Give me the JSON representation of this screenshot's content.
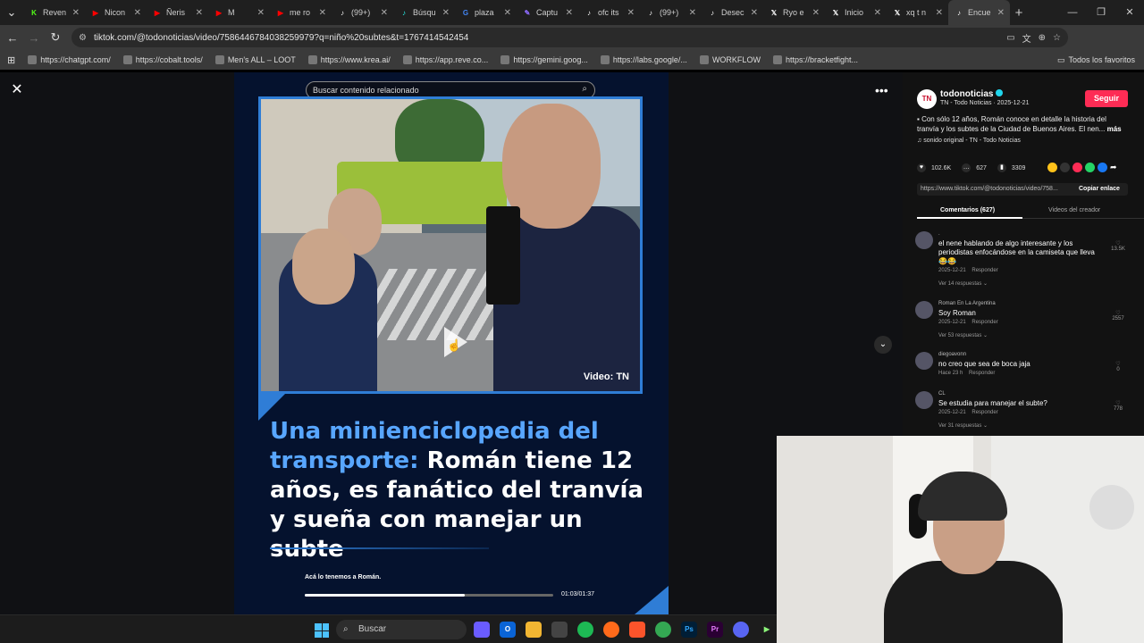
{
  "browser": {
    "tabs": [
      {
        "label": "Reven",
        "icon": "kick-icon",
        "color": "#53fc18"
      },
      {
        "label": "Nicon",
        "icon": "youtube-icon",
        "color": "#ff0000"
      },
      {
        "label": "Ñeris",
        "icon": "youtube-icon",
        "color": "#ff0000"
      },
      {
        "label": "M",
        "icon": "youtube-icon",
        "color": "#ff0000"
      },
      {
        "label": "me ro",
        "icon": "youtube-icon",
        "color": "#ff0000"
      },
      {
        "label": "(99+)",
        "icon": "tiktok-icon",
        "color": "#ffffff"
      },
      {
        "label": "Búsqu",
        "icon": "tiktok-icon",
        "color": "#25f4ee"
      },
      {
        "label": "plaza",
        "icon": "google-icon",
        "color": "#4285f4"
      },
      {
        "label": "Captu",
        "icon": "feather-icon",
        "color": "#8e6cff"
      },
      {
        "label": "ofc its",
        "icon": "tiktok-icon",
        "color": "#ffffff"
      },
      {
        "label": "(99+)",
        "icon": "tiktok-icon",
        "color": "#ffffff"
      },
      {
        "label": "Desec",
        "icon": "tiktok-icon",
        "color": "#ffffff"
      },
      {
        "label": "Ryo e",
        "icon": "x-icon",
        "color": "#ffffff"
      },
      {
        "label": "Inicio",
        "icon": "x-icon",
        "color": "#ffffff"
      },
      {
        "label": "xq t n",
        "icon": "x-icon",
        "color": "#ffffff"
      },
      {
        "label": "Encue",
        "icon": "tiktok-icon",
        "color": "#ffffff"
      }
    ],
    "url": "tiktok.com/@todonoticias/video/7586446784038259979?q=niño%20subtes&t=1767414542454",
    "bookmarks": [
      "https://chatgpt.com/",
      "https://cobalt.tools/",
      "Men's ALL – LOOT",
      "https://www.krea.ai/",
      "https://app.reve.co...",
      "https://gemini.goog...",
      "https://labs.google/...",
      "WORKFLOW",
      "https://bracketfight..."
    ],
    "all_bookmarks": "Todos los favoritos"
  },
  "video": {
    "search_placeholder": "Buscar contenido relacionado",
    "credit": "Video: TN",
    "caption_highlight": "Una minienciclopedia del transporte:",
    "caption_rest": " Román tiene 12 años, es fanático del tranvía y sueña con manejar un subte",
    "subtitle": "Acá lo tenemos a Román.",
    "time": "01:03/01:37",
    "progress_fraction": 0.645
  },
  "panel": {
    "author": "todonoticias",
    "author_sub": "TN - Todo Noticias · 2025-12-21",
    "follow": "Seguir",
    "description": "Con sólo 12 años, Román conoce en detalle la historia del tranvía y los subtes de la Ciudad de Buenos Aires. El nen...",
    "description_more": "más",
    "sound": "sonido original - TN - Todo Noticias",
    "likes": "102.6K",
    "comments_count": "627",
    "saves": "3309",
    "link": "https://www.tiktok.com/@todonoticias/video/758...",
    "copy_link": "Copiar enlace",
    "tab_comments": "Comentarios (627)",
    "tab_creator": "Videos del creador",
    "comments": [
      {
        "name": ".",
        "text": "el nene hablando de algo interesante y los periodistas enfocándose en la camiseta que lleva",
        "emoji": "😂😂",
        "date": "2025-12-21",
        "reply": "Responder",
        "more": "Ver 14 respuestas",
        "likes": "13.5K"
      },
      {
        "name": "Roman En La Argentina",
        "text": "Soy Roman",
        "date": "2025-12-21",
        "reply": "Responder",
        "more": "Ver 53 respuestas",
        "likes": "2557"
      },
      {
        "name": "diegoavonn",
        "text": "no creo que sea de boca jaja",
        "date": "Hace 23 h",
        "reply": "Responder",
        "more": "",
        "likes": "0"
      },
      {
        "name": "CL",
        "text": "Se estudia para manejar el subte?",
        "date": "2025-12-21",
        "reply": "Responder",
        "more": "Ver 31 respuestas",
        "likes": "778"
      }
    ]
  },
  "taskbar": {
    "search": "Buscar"
  }
}
